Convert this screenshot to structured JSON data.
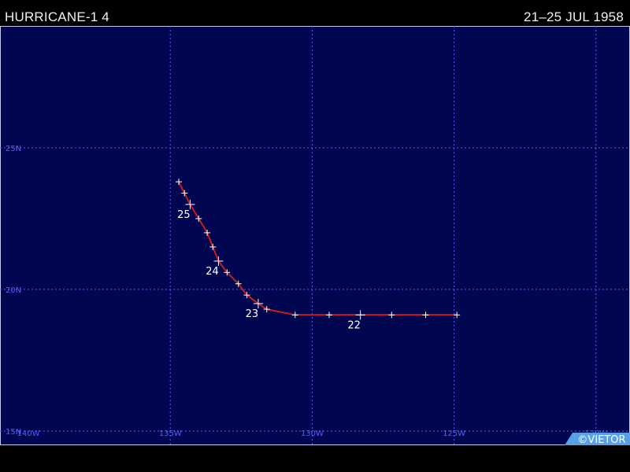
{
  "header": {
    "storm_name": "HURRICANE-1 4",
    "date_range": "21–25 JUL 1958"
  },
  "map": {
    "background_color": "#00064f",
    "grid_color": "#5a5aff",
    "track_color": "#c81e1e",
    "tick_color": "#ffffff",
    "lon_range": [
      -141.0,
      -118.8
    ],
    "lat_range": [
      14.5,
      29.3
    ],
    "lon_lines": [
      -135,
      -130,
      -125,
      -120
    ],
    "lat_lines": [
      25,
      20,
      15
    ],
    "lon_labels": [
      {
        "lon": -140,
        "text": "140W"
      },
      {
        "lon": -135,
        "text": "135W"
      },
      {
        "lon": -130,
        "text": "130W"
      },
      {
        "lon": -125,
        "text": "125W"
      },
      {
        "lon": -120,
        "text": "120W"
      }
    ],
    "lat_labels": [
      {
        "lat": 25,
        "text": "25N"
      },
      {
        "lat": 20,
        "text": "20N"
      },
      {
        "lat": 15,
        "text": "15N"
      }
    ],
    "track": [
      {
        "lon": -124.9,
        "lat": 19.1
      },
      {
        "lon": -126.0,
        "lat": 19.1
      },
      {
        "lon": -127.2,
        "lat": 19.1
      },
      {
        "lon": -128.3,
        "lat": 19.1,
        "major": true,
        "label": "22"
      },
      {
        "lon": -129.4,
        "lat": 19.1
      },
      {
        "lon": -130.6,
        "lat": 19.1
      },
      {
        "lon": -131.6,
        "lat": 19.3
      },
      {
        "lon": -131.9,
        "lat": 19.5,
        "major": true,
        "label": "23"
      },
      {
        "lon": -132.3,
        "lat": 19.8
      },
      {
        "lon": -132.6,
        "lat": 20.2
      },
      {
        "lon": -133.0,
        "lat": 20.6
      },
      {
        "lon": -133.3,
        "lat": 21.0,
        "major": true,
        "label": "24"
      },
      {
        "lon": -133.5,
        "lat": 21.5
      },
      {
        "lon": -133.7,
        "lat": 22.0
      },
      {
        "lon": -134.0,
        "lat": 22.5
      },
      {
        "lon": -134.3,
        "lat": 23.0,
        "major": true,
        "label": "25"
      },
      {
        "lon": -134.5,
        "lat": 23.4
      },
      {
        "lon": -134.7,
        "lat": 23.8
      }
    ],
    "credit": "©VIETOR"
  }
}
